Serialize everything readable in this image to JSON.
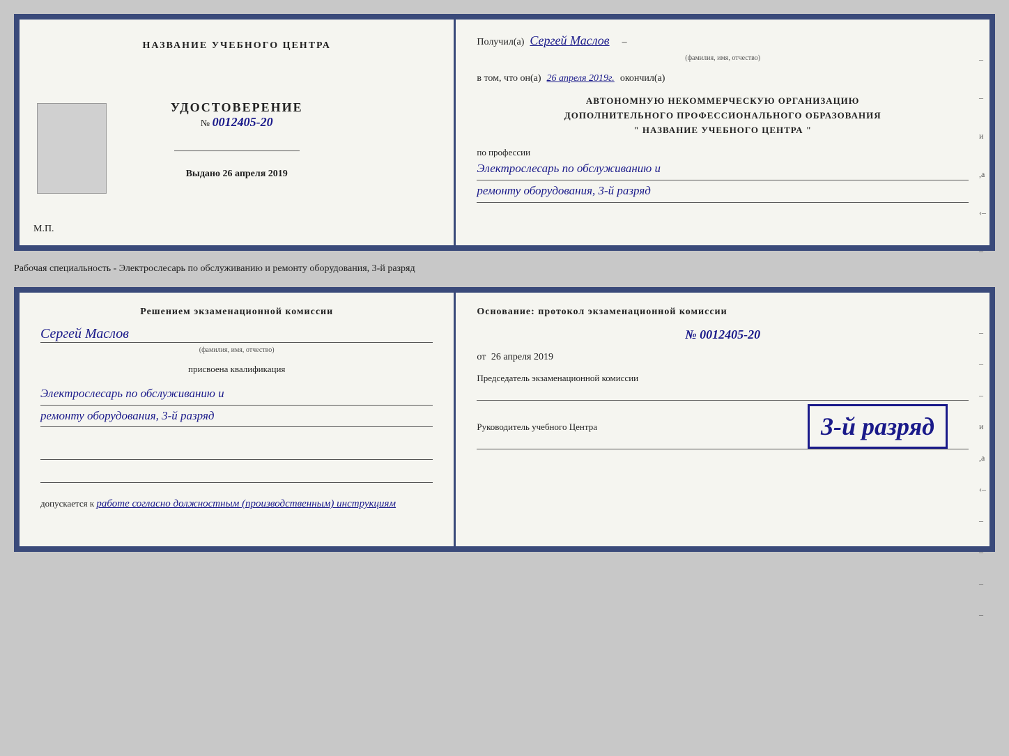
{
  "topCert": {
    "left": {
      "orgName": "НАЗВАНИЕ УЧЕБНОГО ЦЕНТРА",
      "certTitle": "УДОСТОВЕРЕНИЕ",
      "certNumberLabel": "№",
      "certNumber": "0012405-20",
      "issuedLabel": "Выдано",
      "issuedDate": "26 апреля 2019",
      "mpLabel": "М.П."
    },
    "right": {
      "receivedLabel": "Получил(а)",
      "recipientName": "Сергей Маслов",
      "recipientSubLabel": "(фамилия, имя, отчество)",
      "inThatLabel": "в том, что он(а)",
      "completedDate": "26 апреля 2019г.",
      "completedLabel": "окончил(а)",
      "orgBlock1": "АВТОНОМНУЮ НЕКОММЕРЧЕСКУЮ ОРГАНИЗАЦИЮ",
      "orgBlock2": "ДОПОЛНИТЕЛЬНОГО ПРОФЕССИОНАЛЬНОГО ОБРАЗОВАНИЯ",
      "orgBlock3": "\"   НАЗВАНИЕ УЧЕБНОГО ЦЕНТРА   \"",
      "professionLabel": "по профессии",
      "professionLine1": "Электрослесарь по обслуживанию и",
      "professionLine2": "ремонту оборудования, 3-й разряд"
    }
  },
  "betweenText": "Рабочая специальность - Электрослесарь по обслуживанию и ремонту оборудования, 3-й разряд",
  "bottomCert": {
    "left": {
      "commissionTitle": "Решением экзаменационной комиссии",
      "personName": "Сергей Маслов",
      "personSubLabel": "(фамилия, имя, отчество)",
      "qualificationLabel": "присвоена квалификация",
      "qualificationLine1": "Электрослесарь по обслуживанию и",
      "qualificationLine2": "ремонту оборудования, 3-й разряд",
      "admittedLabel": "допускается к",
      "admittedValue": "работе согласно должностным (производственным) инструкциям"
    },
    "right": {
      "basisLabel": "Основание: протокол экзаменационной комиссии",
      "docNumber": "№  0012405-20",
      "docDateLabel": "от",
      "docDate": "26 апреля 2019",
      "commissionChairLabel": "Председатель экзаменационной комиссии",
      "stampText": "3-й разряд",
      "headLabel": "Руководитель учебного Центра"
    }
  }
}
